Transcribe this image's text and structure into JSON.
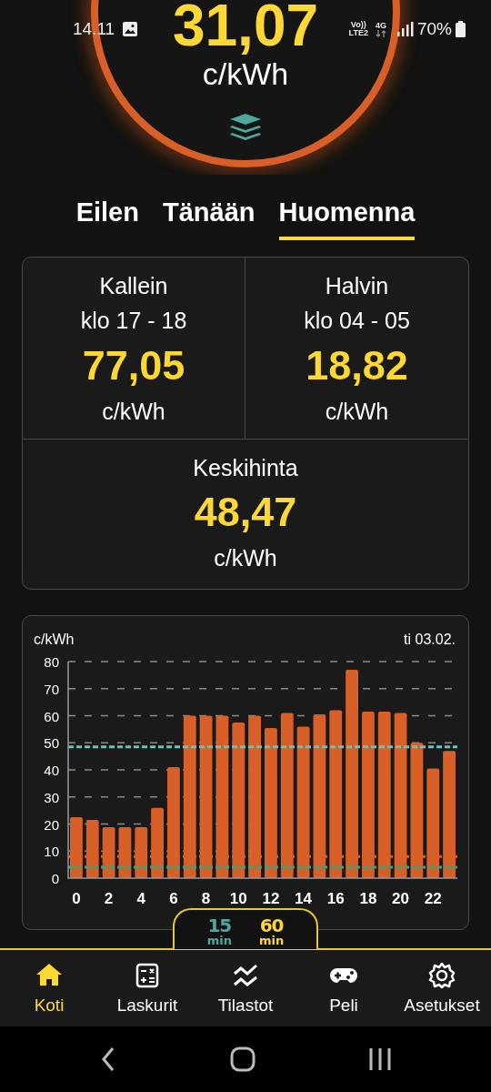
{
  "status_bar": {
    "time": "14.11",
    "volte": "Vo))",
    "lte": "LTE2",
    "network": "4G",
    "battery": "70%"
  },
  "current_price": {
    "value": "31,07",
    "unit": "c/kWh"
  },
  "day_tabs": [
    {
      "label": "Eilen",
      "selected": false
    },
    {
      "label": "Tänään",
      "selected": false
    },
    {
      "label": "Huomenna",
      "selected": true
    }
  ],
  "stats": [
    {
      "kind": "max",
      "title": "Kallein",
      "time": "klo 17 - 18",
      "value": "77,05",
      "unit": "c/kWh"
    },
    {
      "kind": "min",
      "title": "Halvin",
      "time": "klo 04 - 05",
      "value": "18,82",
      "unit": "c/kWh"
    },
    {
      "kind": "avg",
      "title": "Keskihinta",
      "value": "48,47",
      "unit": "c/kWh"
    }
  ],
  "chart": {
    "date": "ti 03.02.",
    "chart_data": {
      "type": "bar",
      "ylabel": "c/kWh",
      "xlim": [
        -0.5,
        23.5
      ],
      "x": [
        0,
        1,
        2,
        3,
        4,
        5,
        6,
        7,
        8,
        9,
        10,
        11,
        12,
        13,
        14,
        15,
        16,
        17,
        18,
        19,
        20,
        21,
        22,
        23
      ],
      "series": [
        {
          "color": "#d85f27",
          "values": [
            22.5,
            21.5,
            18.8,
            18.8,
            18.8,
            26,
            41,
            60,
            60,
            60,
            57.5,
            60,
            55.5,
            61,
            56,
            60.5,
            62,
            77,
            61.5,
            61.5,
            61,
            50,
            40.5,
            47
          ]
        }
      ],
      "ylim": [
        0,
        80
      ],
      "yticks": [
        0,
        10,
        20,
        30,
        40,
        50,
        60,
        70,
        80
      ],
      "xticks": [
        0,
        2,
        4,
        6,
        8,
        10,
        12,
        14,
        16,
        18,
        20,
        22
      ],
      "grid": true,
      "ref_lines": [
        {
          "axis": "y",
          "value": 48.47,
          "color": "#5ec8bd"
        },
        {
          "axis": "y",
          "value": 8,
          "color": "#d85f27"
        },
        {
          "axis": "y",
          "value": 4,
          "color": "#3fa07a"
        }
      ]
    }
  },
  "interval_toggle": [
    {
      "value": "15",
      "unit": "min",
      "selected": false
    },
    {
      "value": "60",
      "unit": "min",
      "selected": true
    }
  ],
  "bottom_nav": [
    {
      "label": "Koti",
      "selected": true
    },
    {
      "label": "Laskurit",
      "selected": false
    },
    {
      "label": "Tilastot",
      "selected": false
    },
    {
      "label": "Peli",
      "selected": false
    },
    {
      "label": "Asetukset",
      "selected": false
    }
  ]
}
